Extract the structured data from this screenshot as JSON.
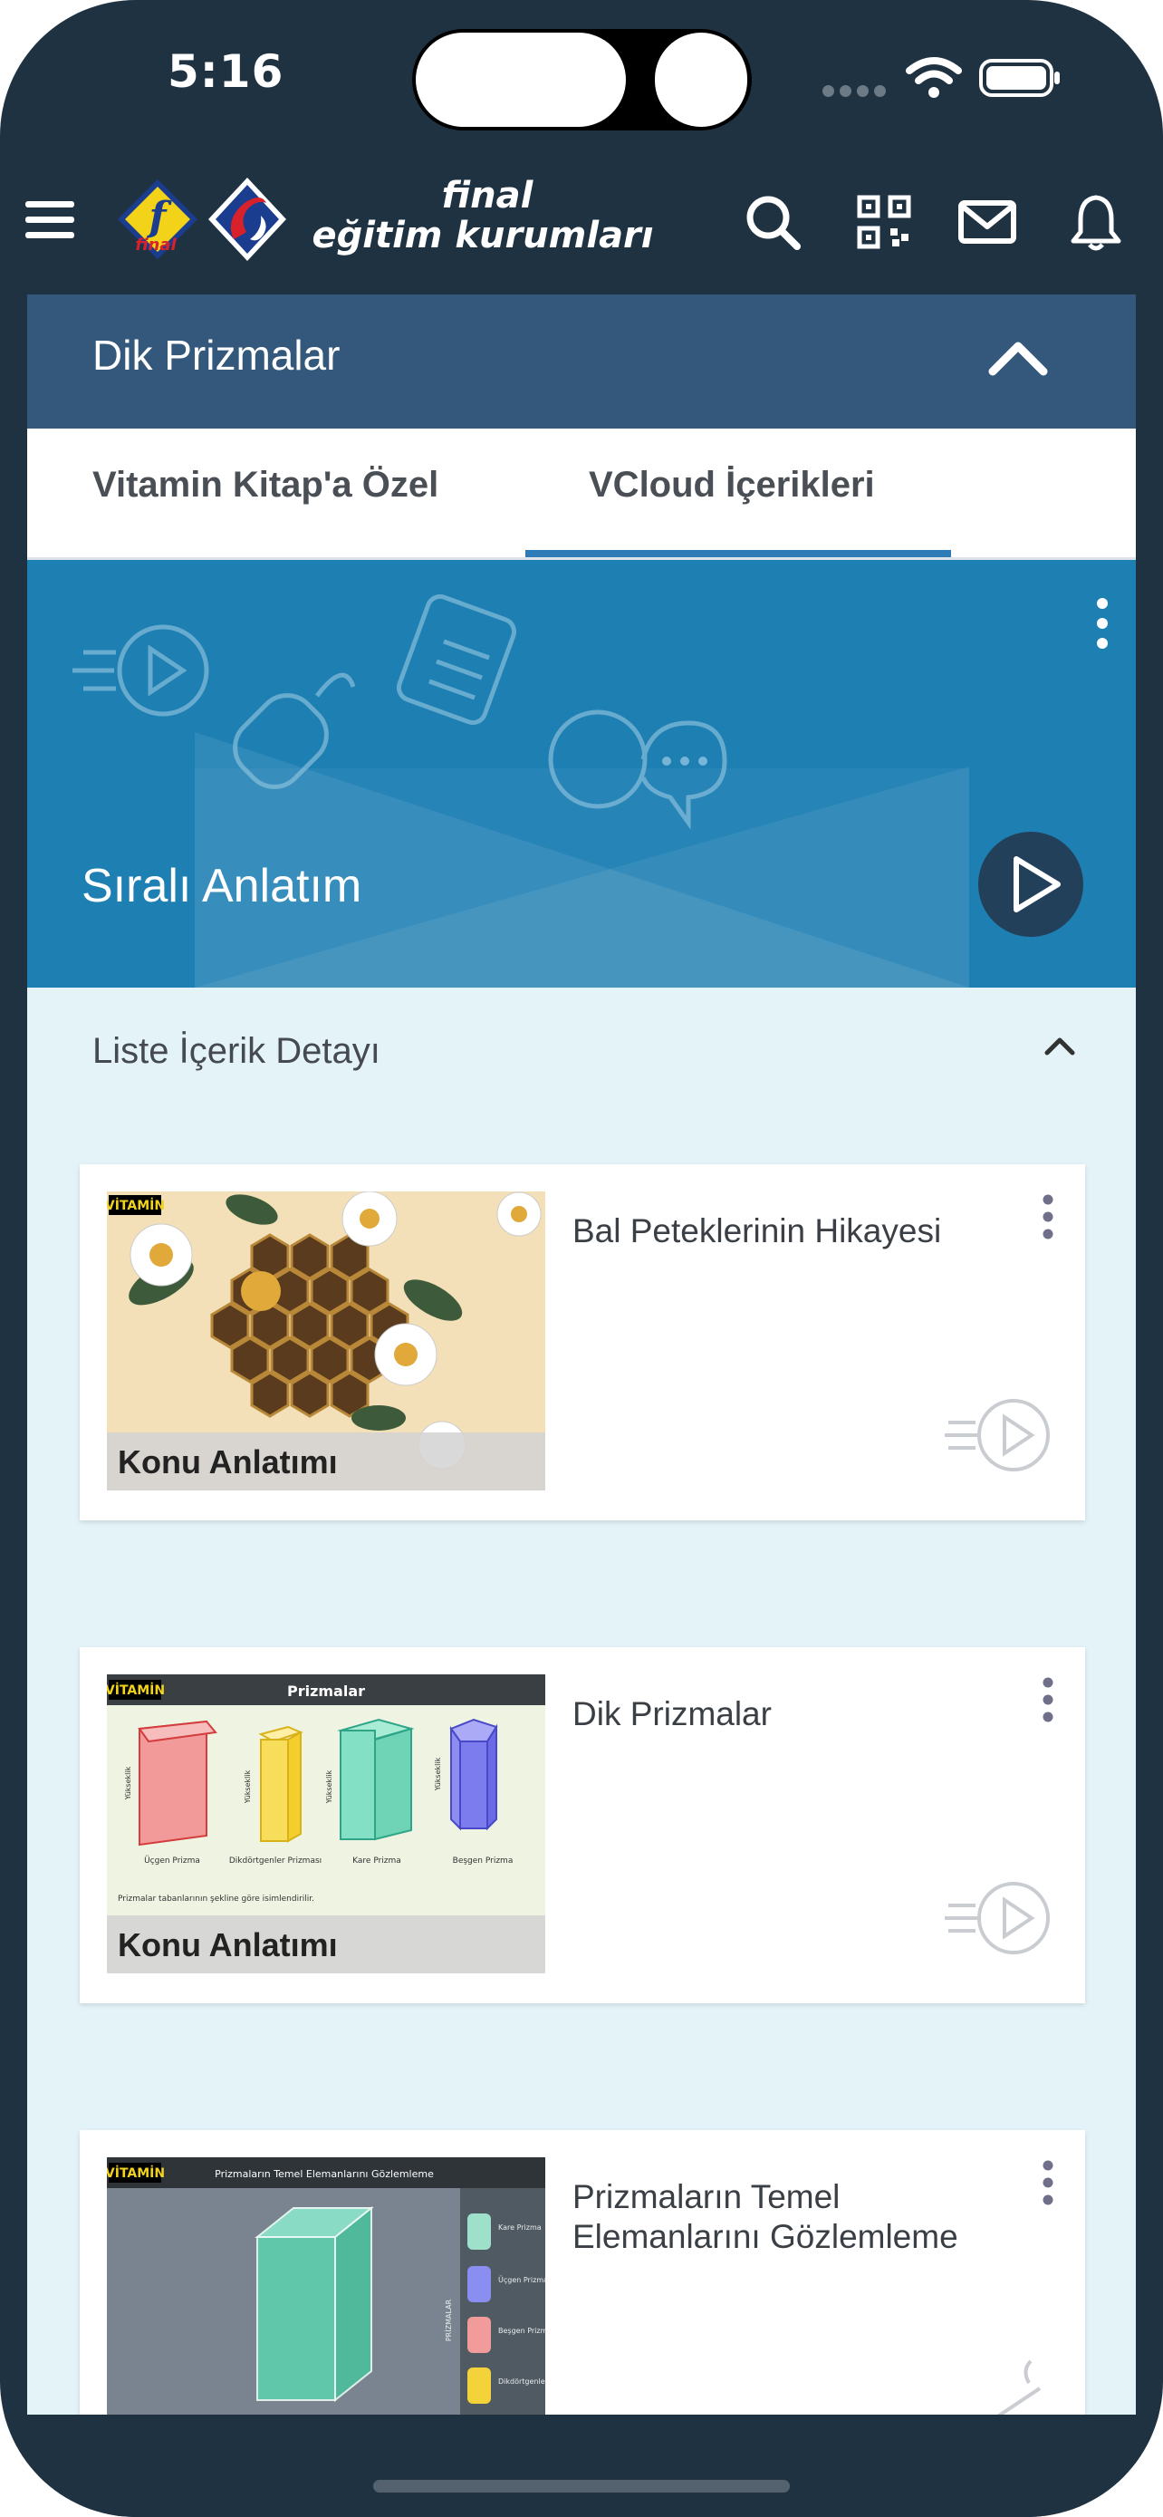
{
  "status_bar": {
    "time": "5:16"
  },
  "header": {
    "brand_line1": "final",
    "brand_line2": "eğitim kurumları",
    "logo_small_text": "final",
    "icons": [
      "menu-icon",
      "search-icon",
      "qr-code-icon",
      "mail-icon",
      "bell-icon"
    ]
  },
  "accordion": {
    "title": "Dik Prizmalar"
  },
  "tabs": [
    {
      "label": "Vitamin Kitap'a Özel",
      "active": false
    },
    {
      "label": "VCloud İçerikleri",
      "active": true
    }
  ],
  "hero": {
    "title": "Sıralı Anlatım"
  },
  "list": {
    "title": "Liste İçerik Detayı",
    "items": [
      {
        "title": "Bal Peteklerinin Hikayesi",
        "tag": "Konu Anlatımı",
        "thumb_brand": "VİTAMİN"
      },
      {
        "title": "Dik Prizmalar",
        "tag": "Konu Anlatımı",
        "thumb_brand": "VİTAMİN",
        "thumb_heading": "Prizmalar",
        "thumb_labels": [
          "Üçgen Prizma",
          "Dikdörtgenler Prizması",
          "Kare Prizma",
          "Beşgen Prizma"
        ],
        "thumb_axis_label": "Yükseklik",
        "thumb_caption": "Prizmalar tabanlarının şekline göre isimlendirilir."
      },
      {
        "title": "Prizmaların Temel Elemanlarını Gözlemleme",
        "thumb_brand": "VİTAMİN",
        "thumb_heading": "Prizmaların Temel Elemanlarını Gözlemleme",
        "thumb_side_title": "PRİZMALAR",
        "thumb_side_items": [
          "Kare Prizma",
          "Üçgen Prizma",
          "Beşgen Prizma",
          "Dikdörtgenler Prizması"
        ]
      }
    ]
  },
  "colors": {
    "frame": "#1f3242",
    "accordion": "#34587c",
    "hero": "#1e7fb3",
    "tab_active": "#2f7bb8",
    "list_bg": "#e3f3f8"
  }
}
